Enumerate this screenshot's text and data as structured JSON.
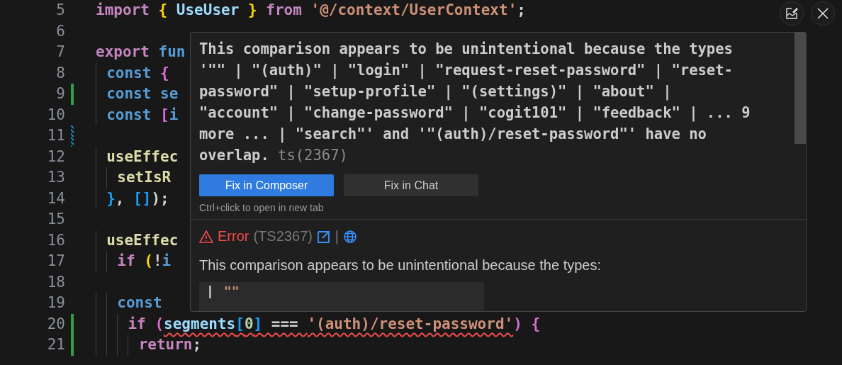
{
  "editor": {
    "lines": [
      {
        "number": "5",
        "added": false,
        "modified": false,
        "tokens": [
          {
            "text": "import ",
            "kind": "keyword"
          },
          {
            "text": "{ ",
            "kind": "bracket1"
          },
          {
            "text": "UseUser ",
            "kind": "var"
          },
          {
            "text": "} ",
            "kind": "bracket1"
          },
          {
            "text": "from ",
            "kind": "keyword"
          },
          {
            "text": "'@/context/UserContext'",
            "kind": "string"
          },
          {
            "text": ";",
            "kind": "punct"
          }
        ]
      },
      {
        "number": "6",
        "added": false,
        "modified": false
      },
      {
        "number": "7",
        "added": false,
        "modified": false,
        "tokens": [
          {
            "text": "export ",
            "kind": "keyword"
          },
          {
            "text": "fun",
            "kind": "storage"
          }
        ]
      },
      {
        "number": "8",
        "added": false,
        "modified": false,
        "tokens": [
          {
            "text": "  const ",
            "kind": "storage"
          },
          {
            "text": "{",
            "kind": "bracket2"
          }
        ]
      },
      {
        "number": "9",
        "added": true,
        "modified": false,
        "tokens": [
          {
            "text": "  const ",
            "kind": "storage"
          },
          {
            "text": "se",
            "kind": "storage"
          }
        ]
      },
      {
        "number": "10",
        "added": false,
        "modified": false,
        "tokens": [
          {
            "text": "  const ",
            "kind": "storage"
          },
          {
            "text": "[",
            "kind": "bracket2"
          },
          {
            "text": "i",
            "kind": "storage"
          }
        ]
      },
      {
        "number": "11",
        "added": false,
        "modified": true
      },
      {
        "number": "12",
        "added": false,
        "modified": false,
        "tokens": [
          {
            "text": "  useEffec",
            "kind": "func"
          }
        ]
      },
      {
        "number": "13",
        "added": false,
        "modified": false,
        "tokens": [
          {
            "text": "    setIsR",
            "kind": "func"
          }
        ]
      },
      {
        "number": "14",
        "added": false,
        "modified": false,
        "tokens": [
          {
            "text": "  }",
            "kind": "bracket3"
          },
          {
            "text": ", ",
            "kind": "punct"
          },
          {
            "text": "[]",
            "kind": "bracket3"
          },
          {
            "text": ");",
            "kind": "punct"
          }
        ]
      },
      {
        "number": "15",
        "added": false,
        "modified": false
      },
      {
        "number": "16",
        "added": false,
        "modified": false,
        "tokens": [
          {
            "text": "  useEffec",
            "kind": "func"
          }
        ]
      },
      {
        "number": "17",
        "added": false,
        "modified": false,
        "tokens": [
          {
            "text": "    if ",
            "kind": "keyword"
          },
          {
            "text": "(",
            "kind": "bracket1"
          },
          {
            "text": "!",
            "kind": "punct"
          },
          {
            "text": "i",
            "kind": "storage"
          }
        ]
      },
      {
        "number": "18",
        "added": false,
        "modified": false
      },
      {
        "number": "19",
        "added": false,
        "modified": false,
        "tokens": [
          {
            "text": "    const",
            "kind": "storage"
          }
        ]
      },
      {
        "number": "20",
        "added": true,
        "modified": false,
        "tokens": [
          {
            "text": "      if ",
            "kind": "keyword"
          },
          {
            "text": "(",
            "kind": "bracket2",
            "error": false
          },
          {
            "text": "segments",
            "kind": "var",
            "error": true
          },
          {
            "text": "[",
            "kind": "bracket3",
            "error": true
          },
          {
            "text": "0",
            "kind": "number",
            "error": true
          },
          {
            "text": "]",
            "kind": "bracket3",
            "error": true
          },
          {
            "text": " === ",
            "kind": "punct",
            "error": true
          },
          {
            "text": "'(auth)/reset-password'",
            "kind": "string",
            "error": true
          },
          {
            "text": ") ",
            "kind": "bracket2",
            "error": false
          },
          {
            "text": "{",
            "kind": "bracket2",
            "error": false
          }
        ]
      },
      {
        "number": "21",
        "added": true,
        "modified": false,
        "tokens": [
          {
            "text": "        return",
            "kind": "keyword"
          },
          {
            "text": ";",
            "kind": "punct"
          }
        ]
      }
    ]
  },
  "hover": {
    "message": "This comparison appears to be unintentional because the types '\"\" | \"(auth)\" | \"login\" | \"request-reset-password\" | \"reset-password\" | \"setup-profile\" | \"(settings)\" | \"about\" | \"account\" | \"change-password\" | \"cogit101\" | \"feedback\" | ... 9 more ... | \"search\"' and '\"(auth)/reset-password\"' have no overlap.",
    "code": "ts(2367)",
    "buttons": [
      {
        "label": "Fix in Composer",
        "primary": true
      },
      {
        "label": "Fix in Chat",
        "primary": false
      }
    ],
    "hint": "Ctrl+click to open in new tab",
    "error_label": "Error",
    "error_code": "(TS2367)",
    "separator": "|",
    "detail": "This comparison appears to be unintentional because the types:",
    "type_list": [
      {
        "bar": "|",
        "value": "\"\""
      }
    ]
  }
}
